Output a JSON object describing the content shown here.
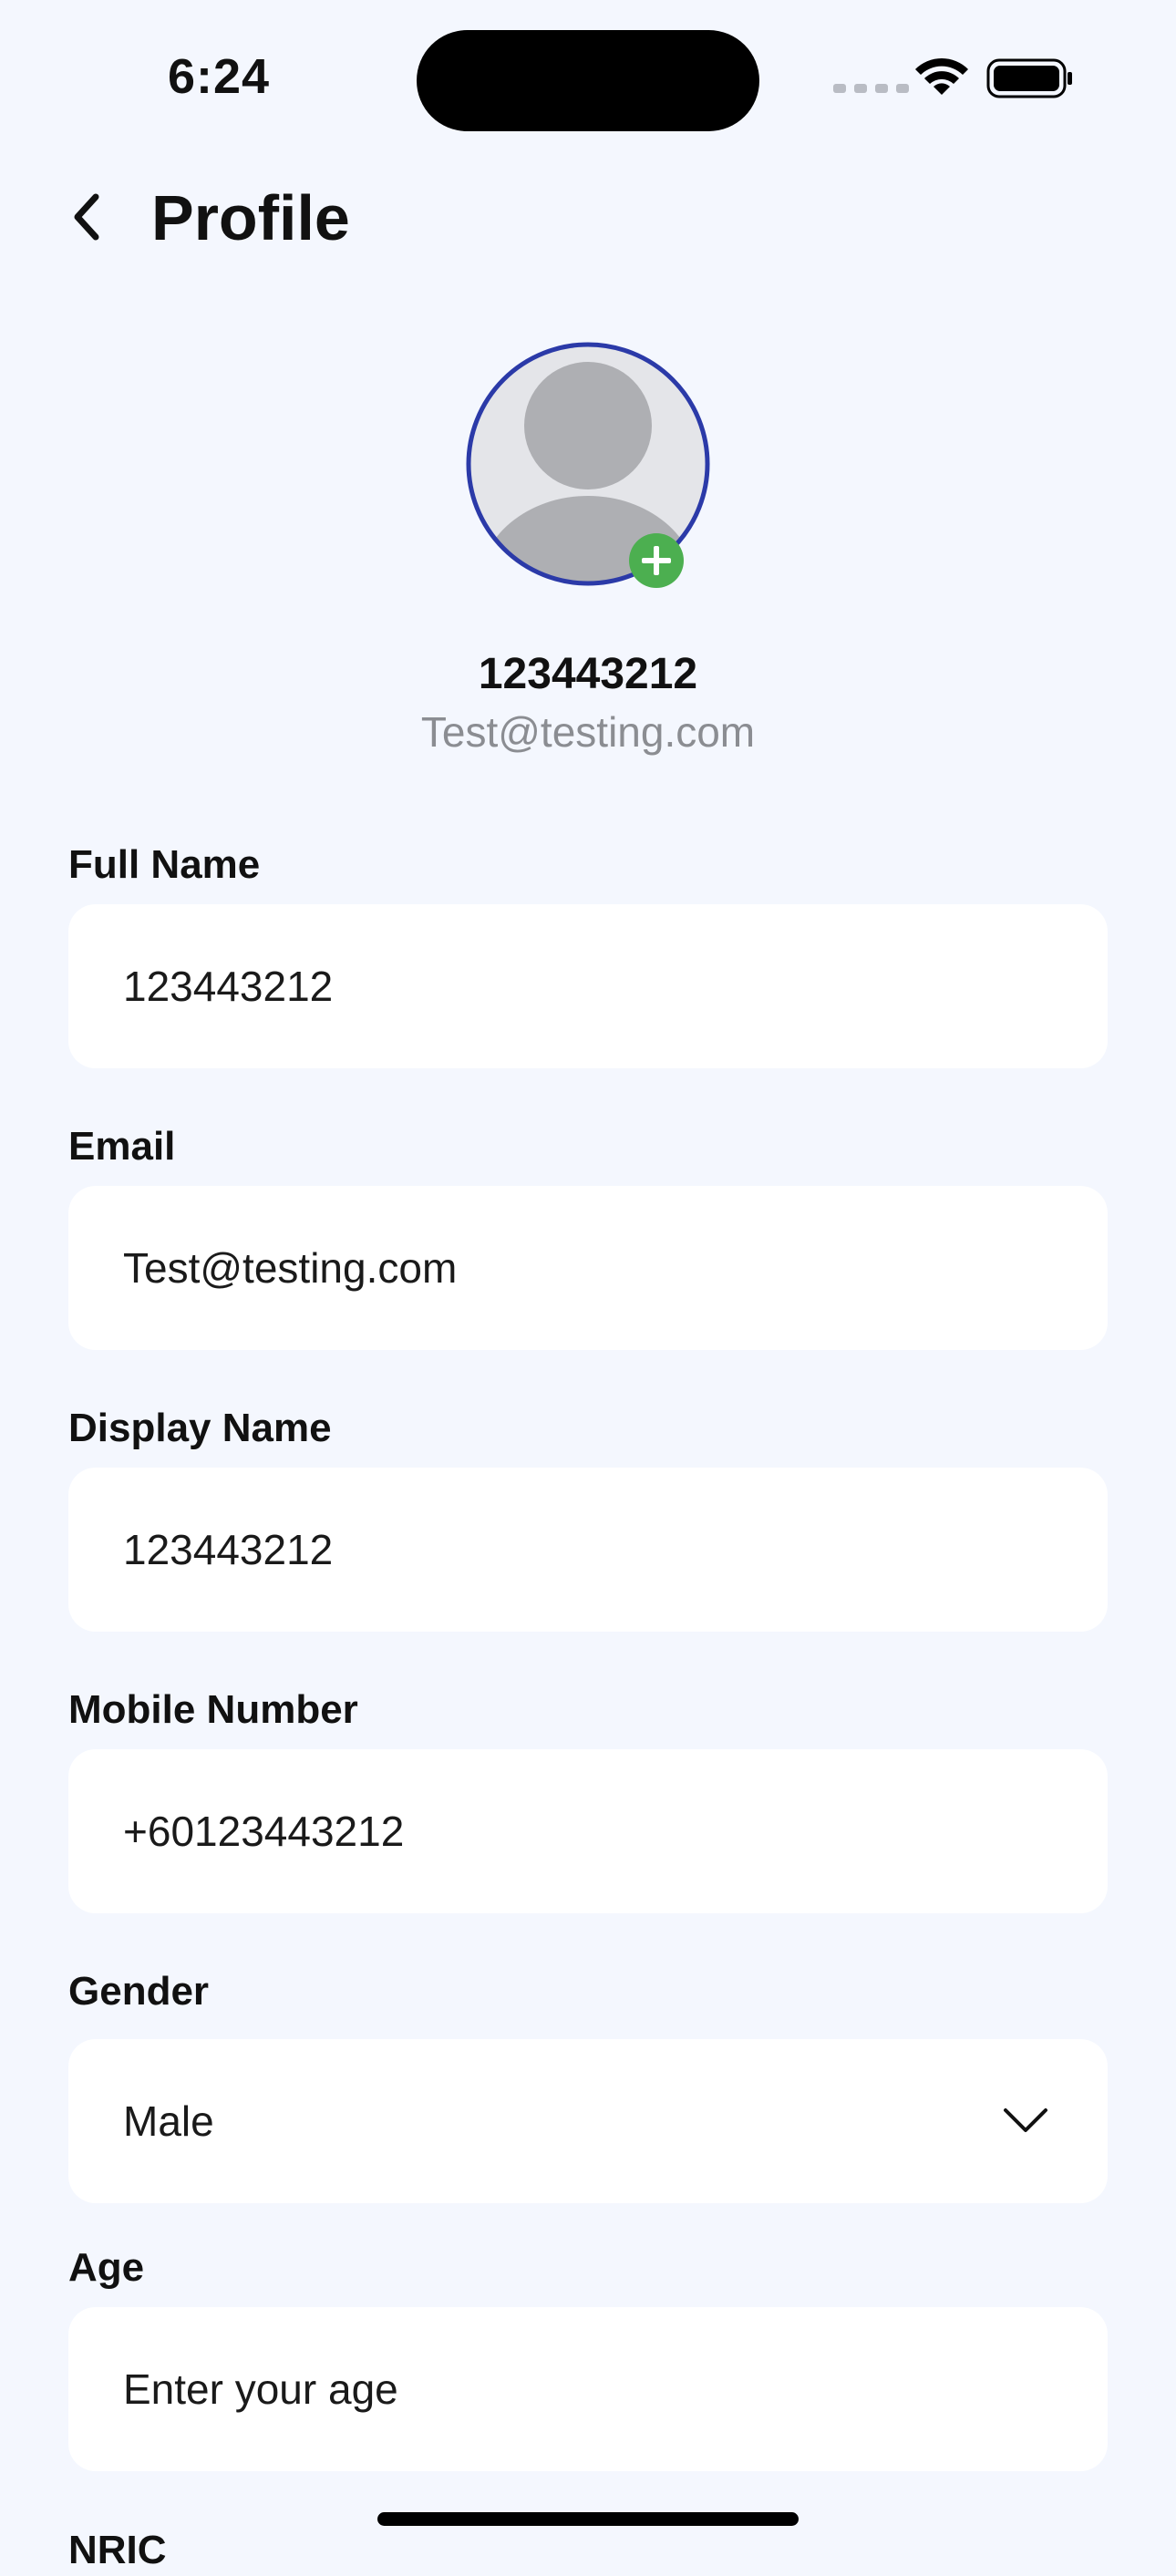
{
  "status_bar": {
    "time": "6:24"
  },
  "header": {
    "title": "Profile",
    "back_icon": "chevron-left-icon"
  },
  "profile": {
    "name": "123443212",
    "email": "Test@testing.com",
    "avatar_icon": "person-placeholder-icon",
    "add_photo_icon": "plus-circle-icon"
  },
  "colors": {
    "background": "#f4f7fe",
    "field_background": "#ffffff",
    "avatar_ring": "#2b3aa8",
    "add_badge": "#4caf50",
    "muted_text": "#8b8d92"
  },
  "form": {
    "full_name": {
      "label": "Full Name",
      "value": "123443212"
    },
    "email": {
      "label": "Email",
      "value": "Test@testing.com"
    },
    "display_name": {
      "label": "Display Name",
      "value": "123443212"
    },
    "mobile_number": {
      "label": "Mobile Number",
      "value": "+60123443212"
    },
    "gender": {
      "label": "Gender",
      "value": "Male"
    },
    "age": {
      "label": "Age",
      "value": "",
      "placeholder": "Enter your age"
    },
    "nric": {
      "label": "NRIC"
    }
  }
}
